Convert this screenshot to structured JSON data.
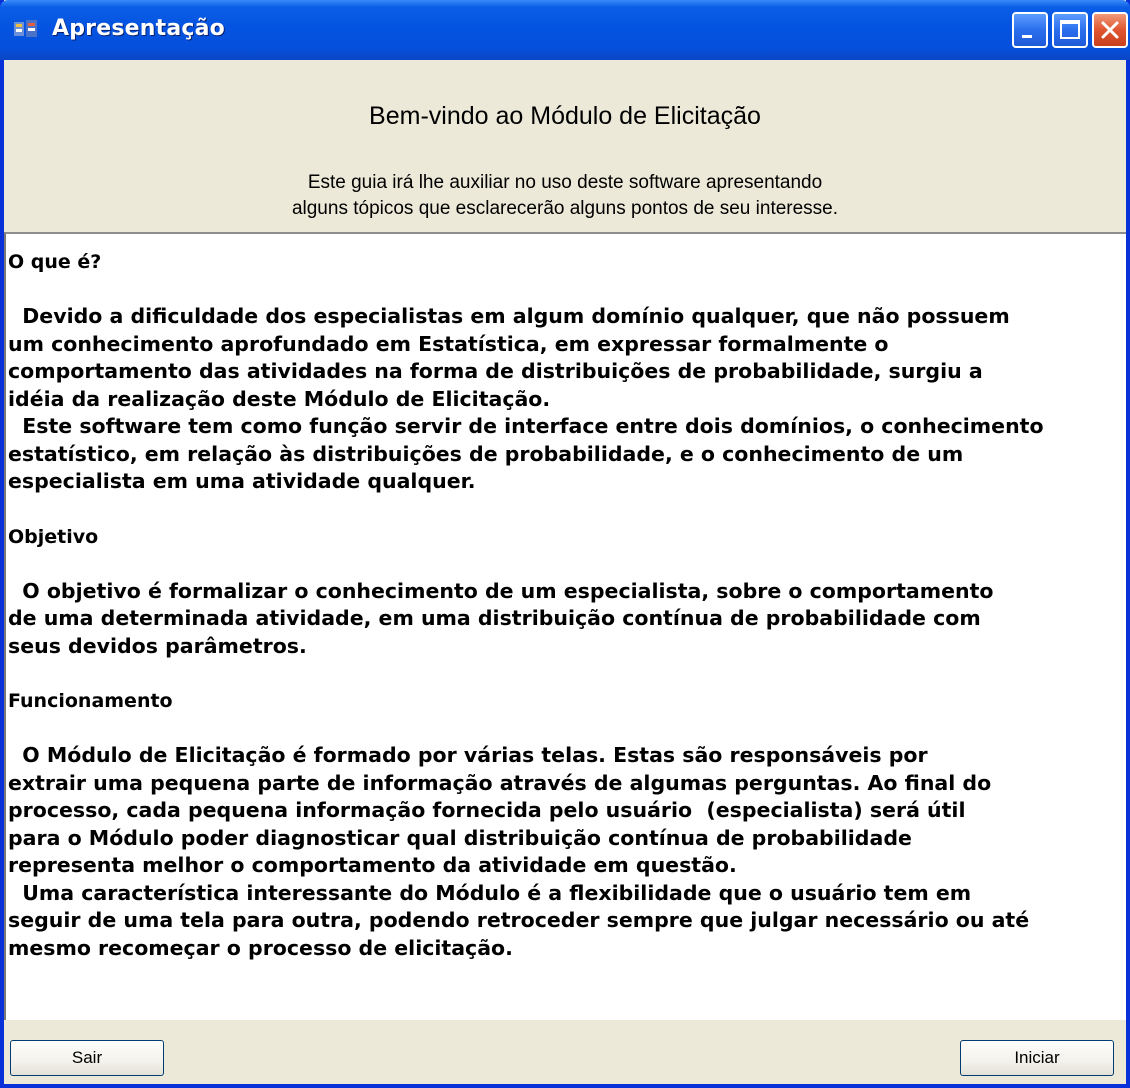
{
  "window": {
    "title": "Apresentação",
    "icon": "app-icon"
  },
  "header": {
    "welcome": "Bem-vindo ao Módulo de Elicitação",
    "intro_line1": "Este guia irá lhe auxiliar no uso deste software apresentando",
    "intro_line2": "alguns tópicos que esclarecerão alguns pontos de seu interesse."
  },
  "content": {
    "sections": [
      {
        "title": "O que é?",
        "paragraphs": [
          "  Devido a dificuldade dos especialistas em algum domínio qualquer, que não possuem\num conhecimento aprofundado em Estatística, em expressar formalmente o\ncomportamento das atividades na forma de distribuições de probabilidade, surgiu a\nidéia da realização deste Módulo de Elicitação.\n  Este software tem como função servir de interface entre dois domínios, o conhecimento\nestatístico, em relação às distribuições de probabilidade, e o conhecimento de um\nespecialista em uma atividade qualquer."
        ]
      },
      {
        "title": "Objetivo",
        "paragraphs": [
          "  O objetivo é formalizar o conhecimento de um especialista, sobre o comportamento\nde uma determinada atividade, em uma distribuição contínua de probabilidade com\nseus devidos parâmetros."
        ]
      },
      {
        "title": "Funcionamento",
        "paragraphs": [
          "  O Módulo de Elicitação é formado por várias telas. Estas são responsáveis por\nextrair uma pequena parte de informação através de algumas perguntas. Ao final do\nprocesso, cada pequena informação fornecida pelo usuário  (especialista) será útil\npara o Módulo poder diagnosticar qual distribuição contínua de probabilidade\nrepresenta melhor o comportamento da atividade em questão.\n  Uma característica interessante do Módulo é a flexibilidade que o usuário tem em\nseguir de uma tela para outra, podendo retroceder sempre que julgar necessário ou até\nmesmo recomeçar o processo de elicitação."
        ]
      }
    ]
  },
  "footer": {
    "exit_label": "Sair",
    "start_label": "Iniciar"
  },
  "colors": {
    "titlebar": "#0553e1",
    "window_bg": "#ece9d8",
    "close_button": "#e0552f"
  }
}
